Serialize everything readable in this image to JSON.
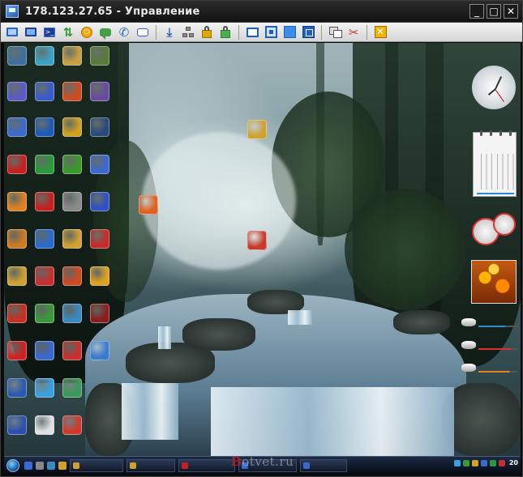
{
  "window": {
    "title": "178.123.27.65 - Управление",
    "controls": {
      "minimize": "_",
      "maximize": "□",
      "close": "✕"
    }
  },
  "toolbar": {
    "buttons": [
      "screen-icon",
      "terminal-icon",
      "file-transfer-icon",
      "power-icon",
      "chat-icon",
      "phone-icon",
      "message-icon",
      "download-icon",
      "network-icon",
      "lock-icon",
      "unlock-icon",
      "window-mode-icon",
      "fit-icon",
      "fullscreen-icon",
      "scale-icon",
      "copy-icon",
      "tools-icon",
      "close-session-icon"
    ]
  },
  "desktop": {
    "icons": [
      {
        "name": "desktop-icon-1",
        "color": "#3c6ea0"
      },
      {
        "name": "desktop-icon-2",
        "color": "#3aa3c8"
      },
      {
        "name": "desktop-icon-3",
        "color": "#c8a040"
      },
      {
        "name": "desktop-icon-4",
        "color": "#5a7a3a"
      },
      {
        "name": "desktop-icon-5",
        "color": "#5a5ac8"
      },
      {
        "name": "desktop-icon-6",
        "color": "#3a5ad0"
      },
      {
        "name": "desktop-icon-7",
        "color": "#d04a20"
      },
      {
        "name": "desktop-icon-8",
        "color": "#6a4aa0"
      },
      {
        "name": "desktop-icon-9",
        "color": "#3a6ad0"
      },
      {
        "name": "desktop-icon-10",
        "color": "#1e5ab8"
      },
      {
        "name": "desktop-icon-11",
        "color": "#d0a020"
      },
      {
        "name": "desktop-icon-12",
        "color": "#2a4a7a"
      },
      {
        "name": "desktop-icon-13",
        "color": "#c8201e"
      },
      {
        "name": "desktop-icon-14",
        "color": "#2a9a3a"
      },
      {
        "name": "desktop-icon-15",
        "color": "#3a9a2a"
      },
      {
        "name": "desktop-icon-16",
        "color": "#3a6ad0"
      },
      {
        "name": "desktop-icon-17",
        "color": "#e08020"
      },
      {
        "name": "desktop-icon-18",
        "color": "#c82020"
      },
      {
        "name": "desktop-icon-19",
        "color": "#8a8a8a"
      },
      {
        "name": "desktop-icon-20",
        "color": "#3050c8"
      },
      {
        "name": "desktop-icon-21",
        "color": "#e06020"
      },
      {
        "name": "desktop-icon-22",
        "color": "#d07a20"
      },
      {
        "name": "desktop-icon-23",
        "color": "#2a6ad0"
      },
      {
        "name": "desktop-icon-24",
        "color": "#d0a030"
      },
      {
        "name": "desktop-icon-25",
        "color": "#c82a2a"
      },
      {
        "name": "desktop-icon-26",
        "color": "#d0a030"
      },
      {
        "name": "desktop-icon-27",
        "color": "#c83a2a"
      },
      {
        "name": "desktop-icon-28",
        "color": "#d0a030"
      },
      {
        "name": "desktop-icon-29",
        "color": "#c83030"
      },
      {
        "name": "desktop-icon-30",
        "color": "#d04a20"
      },
      {
        "name": "desktop-icon-31",
        "color": "#e0a020"
      },
      {
        "name": "desktop-icon-32",
        "color": "#c83020"
      },
      {
        "name": "desktop-icon-33",
        "color": "#3a9a3a"
      },
      {
        "name": "desktop-icon-34",
        "color": "#3a8ac0"
      },
      {
        "name": "desktop-icon-35",
        "color": "#8a1e1e"
      },
      {
        "name": "desktop-icon-36",
        "color": "#d02020"
      },
      {
        "name": "desktop-icon-37",
        "color": "#3a6ad0"
      },
      {
        "name": "desktop-icon-38",
        "color": "#c83030"
      },
      {
        "name": "desktop-icon-39",
        "color": "#3a7ad0"
      },
      {
        "name": "desktop-icon-40",
        "color": "#2a5ab0"
      },
      {
        "name": "desktop-icon-41",
        "color": "#3aa0e0"
      },
      {
        "name": "desktop-icon-42",
        "color": "#3a9a5a"
      },
      {
        "name": "desktop-icon-43",
        "color": "#2a50b0"
      },
      {
        "name": "desktop-icon-44",
        "color": "#e0e0e0"
      },
      {
        "name": "desktop-icon-45",
        "color": "#d03a2a"
      }
    ]
  },
  "taskbar": {
    "tasks": [
      {
        "name": "task-1",
        "color": "#d0a030"
      },
      {
        "name": "task-2",
        "color": "#d0a030"
      },
      {
        "name": "task-3",
        "color": "#c82020"
      },
      {
        "name": "task-4",
        "color": "#3a6ad0"
      },
      {
        "name": "task-5",
        "color": "#3a6ad0"
      }
    ],
    "clock": "20"
  },
  "watermark": {
    "prefix": "B",
    "rest": "otvet.ru"
  }
}
